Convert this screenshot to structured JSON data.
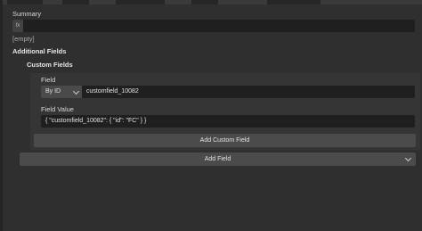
{
  "summary": {
    "label": "Summary",
    "fx_label": "fx",
    "value": "",
    "empty_text": "[empty]"
  },
  "additional_fields": {
    "heading": "Additional Fields"
  },
  "custom_fields": {
    "heading": "Custom Fields",
    "field_label": "Field",
    "field_mode": "By ID",
    "field_value": "customfield_10082",
    "value_label": "Field Value",
    "value_value": "{ \"customfield_10082\": { \"id\": \"FC\" } }",
    "add_button": "Add Custom Field"
  },
  "add_field": {
    "label": "Add Field"
  }
}
